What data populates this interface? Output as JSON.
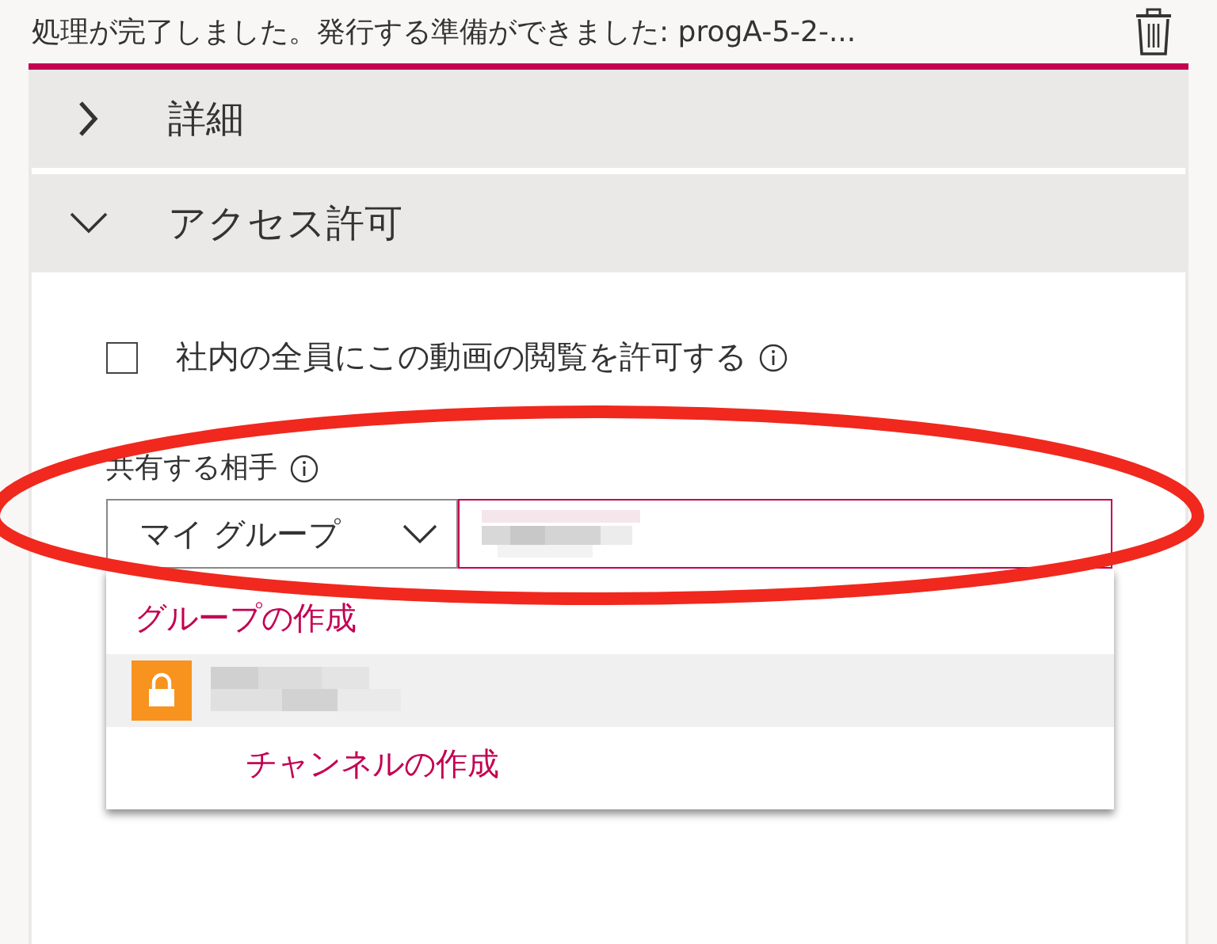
{
  "notification": {
    "message": "処理が完了しました。発行する準備ができました: progA-5-2-..."
  },
  "sections": [
    {
      "title": "詳細",
      "expanded": false
    },
    {
      "title": "アクセス許可",
      "expanded": true
    }
  ],
  "permission": {
    "label": "社内の全員にこの動画の閲覧を許可する",
    "checked": false
  },
  "share": {
    "label": "共有する相手",
    "scope": "マイ グループ"
  },
  "dropdown": {
    "items": [
      {
        "kind": "action",
        "label": "グループの作成",
        "selected": false
      },
      {
        "kind": "group",
        "selected": true
      },
      {
        "kind": "child-action",
        "label": "チャンネルの作成",
        "selected": false
      }
    ]
  }
}
